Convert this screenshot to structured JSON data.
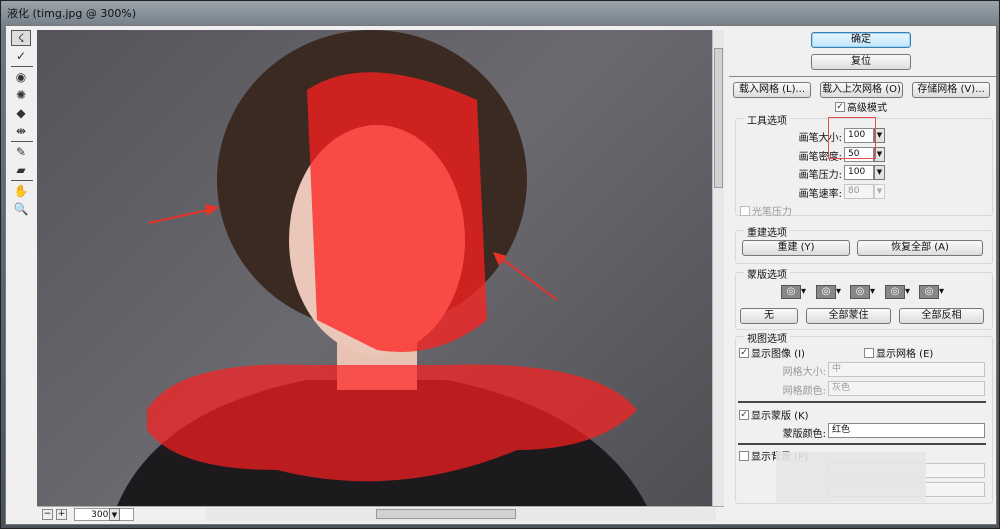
{
  "window": {
    "title": "液化 (timg.jpg @ 300%)"
  },
  "toolbar": {
    "tools": [
      "forward-warp",
      "reconstruct",
      "twirl-clockwise",
      "pucker",
      "bloat",
      "push-left",
      "freeze-mask",
      "thaw-mask",
      "hand",
      "zoom"
    ]
  },
  "canvas": {
    "zoom": "300%",
    "zoom_out": "−",
    "zoom_in": "+"
  },
  "buttons": {
    "ok": "确定",
    "reset": "复位",
    "load_mesh": "载入网格 (L)...",
    "load_last_mesh": "载入上次网格 (O)",
    "save_mesh": "存储网格 (V)..."
  },
  "advanced_mode": {
    "label": "高级模式",
    "checked": true
  },
  "tool_options": {
    "title": "工具选项",
    "brush_size_label": "画笔大小:",
    "brush_size": "100",
    "brush_density_label": "画笔密度:",
    "brush_density": "50",
    "brush_pressure_label": "画笔压力:",
    "brush_pressure": "100",
    "brush_rate_label": "画笔速率:",
    "brush_rate": "80",
    "stylus_pressure": "光笔压力"
  },
  "reconstruct_options": {
    "title": "重建选项",
    "reconstruct": "重建 (Y)",
    "restore_all": "恢复全部 (A)"
  },
  "mask_options": {
    "title": "蒙版选项",
    "none": "无",
    "mask_all": "全部蒙住",
    "invert_all": "全部反相"
  },
  "view_options": {
    "title": "视图选项",
    "show_image": "显示图像 (I)",
    "show_mesh": "显示网格 (E)",
    "mesh_size_label": "网格大小:",
    "mesh_size": "中",
    "mesh_color_label": "网格颜色:",
    "mesh_color": "灰色",
    "show_mask": "显示蒙版 (K)",
    "mask_color_label": "蒙版颜色:",
    "mask_color": "红色",
    "show_backdrop": "显示背景 (P)"
  },
  "colors": {
    "mask": "#ff2020",
    "accent": "#3c7fb1",
    "annotation_box": "#e05050",
    "arrow": "#e8322a"
  }
}
